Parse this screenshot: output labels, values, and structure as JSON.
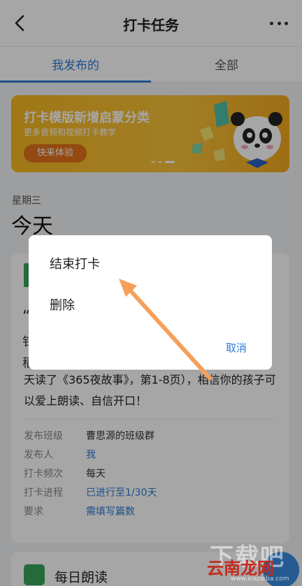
{
  "header": {
    "title": "打卡任务"
  },
  "tabs": [
    {
      "label": "我发布的",
      "active": true
    },
    {
      "label": "全部",
      "active": false
    }
  ],
  "banner": {
    "title": "打卡模版新增启蒙分类",
    "subtitle": "更多音频和视频打卡教学",
    "button": "快来体验"
  },
  "date": {
    "weekday": "星期三",
    "label": "今天"
  },
  "card": {
    "fragments": [
      "“",
      "钅",
      "稻"
    ],
    "text": "天读了《365夜故事》，第1-8页），相信你的孩子可以爱上朗读、自信开口！",
    "info": [
      {
        "key": "发布班级",
        "value": "曹思源的班级群",
        "link": false
      },
      {
        "key": "发布人",
        "value": "我",
        "link": true
      },
      {
        "key": "打卡频次",
        "value": "每天",
        "link": false
      },
      {
        "key": "打卡进程",
        "value": "已进行至1/30天",
        "link": true
      },
      {
        "key": "要求",
        "value": "需填写篇数",
        "link": true
      }
    ]
  },
  "card2": {
    "title": "每日朗读"
  },
  "dialog": {
    "item1": "结束打卡",
    "item2": "删除",
    "cancel": "取消"
  },
  "watermark": {
    "top": "下载吧",
    "brand": "云南龙网",
    "url": "www.xiazaiba.com"
  },
  "colors": {
    "accent": "#2d7bd5",
    "banner": "#f6b820",
    "arrow": "#f5a05a"
  }
}
